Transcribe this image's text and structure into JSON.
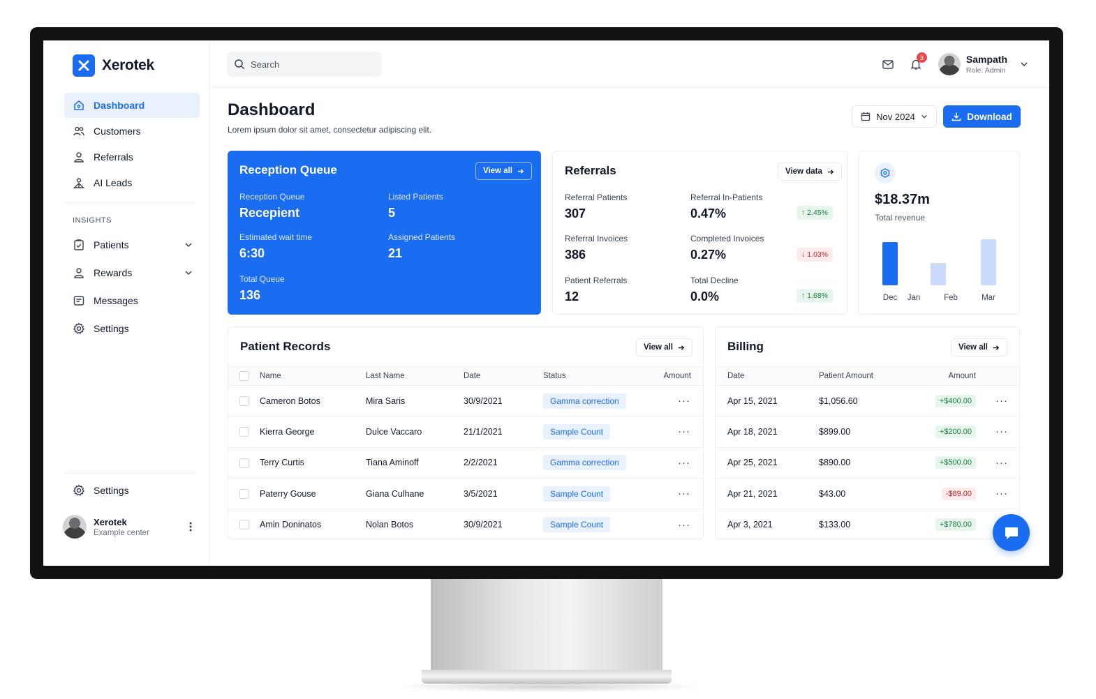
{
  "brand": {
    "name": "Xerotek",
    "accent": "#1a6cf0"
  },
  "sidebar": {
    "nav": [
      {
        "label": "Dashboard",
        "icon": "home-icon",
        "active": true
      },
      {
        "label": "Customers",
        "icon": "users-icon"
      },
      {
        "label": "Referrals",
        "icon": "user-icon"
      },
      {
        "label": "AI Leads",
        "icon": "ai-user-icon"
      }
    ],
    "section_label": "INSIGHTS",
    "insights": [
      {
        "label": "Patients",
        "icon": "clipboard-icon",
        "expandable": true
      },
      {
        "label": "Rewards",
        "icon": "user-icon",
        "expandable": true
      },
      {
        "label": "Messages",
        "icon": "message-icon"
      },
      {
        "label": "Settings",
        "icon": "gear-icon"
      }
    ],
    "bottom_settings": "Settings",
    "user": {
      "name": "Xerotek",
      "subtitle": "Example center"
    }
  },
  "header": {
    "search_placeholder": "Search",
    "notification_count": "3",
    "profile": {
      "name": "Sampath",
      "role": "Role: Admin"
    }
  },
  "page": {
    "title": "Dashboard",
    "subtitle": "Lorem ipsum dolor sit amet, consectetur adipiscing elit.",
    "date_filter": "Nov 2024",
    "download_label": "Download"
  },
  "reception": {
    "title": "Reception Queue",
    "view_all": "View all",
    "stats": [
      {
        "label": "Reception Queue",
        "value": "Recepient"
      },
      {
        "label": "Listed Patients",
        "value": "5"
      },
      {
        "label": "Estimated wait time",
        "value": "6:30"
      },
      {
        "label": "Assigned Patients",
        "value": "21"
      },
      {
        "label": "Total Queue",
        "value": "136"
      }
    ]
  },
  "referrals": {
    "title": "Referrals",
    "view_data": "View data",
    "stats": [
      {
        "label": "Referral Patients",
        "value": "307"
      },
      {
        "label": "Referral In-Patients",
        "value": "0.47%",
        "change": "2.45%",
        "direction": "up"
      },
      {
        "label": "Referral Invoices",
        "value": "386"
      },
      {
        "label": "Completed Invoices",
        "value": "0.27%",
        "change": "1.03%",
        "direction": "down"
      },
      {
        "label": "Patient Referrals",
        "value": "12"
      },
      {
        "label": "Total Decline",
        "value": "0.0%",
        "change": "1.68%",
        "direction": "up"
      }
    ]
  },
  "revenue": {
    "value": "$18.37m",
    "label": "Total revenue",
    "chart_labels": [
      "Dec",
      "Jan",
      "Feb",
      "Mar"
    ]
  },
  "patient_records": {
    "title": "Patient Records",
    "view_all": "View all",
    "columns": [
      "Name",
      "Last Name",
      "Date",
      "Status",
      "Amount"
    ],
    "rows": [
      {
        "name": "Cameron Botos",
        "last": "Mira Saris",
        "date": "30/9/2021",
        "status": "Gamma correction"
      },
      {
        "name": "Kierra George",
        "last": "Dulce Vaccaro",
        "date": "21/1/2021",
        "status": "Sample Count"
      },
      {
        "name": "Terry Curtis",
        "last": "Tiana Aminoff",
        "date": "2/2/2021",
        "status": "Gamma correction"
      },
      {
        "name": "Paterry Gouse",
        "last": "Giana Culhane",
        "date": "3/5/2021",
        "status": "Sample Count"
      },
      {
        "name": "Amin Doninatos",
        "last": "Nolan Botos",
        "date": "30/9/2021",
        "status": "Sample Count"
      }
    ]
  },
  "billing": {
    "title": "Billing",
    "view_all": "View all",
    "columns": [
      "Date",
      "Patient Amount",
      "Amount"
    ],
    "rows": [
      {
        "date": "Apr 15, 2021",
        "patient_amount": "$1,056.60",
        "amount": "+$400.00",
        "positive": true
      },
      {
        "date": "Apr 18, 2021",
        "patient_amount": "$899.00",
        "amount": "+$200.00",
        "positive": true
      },
      {
        "date": "Apr 25, 2021",
        "patient_amount": "$890.00",
        "amount": "+$500.00",
        "positive": true
      },
      {
        "date": "Apr 21, 2021",
        "patient_amount": "$43.00",
        "amount": "-$89.00",
        "positive": false
      },
      {
        "date": "Apr 3, 2021",
        "patient_amount": "$133.00",
        "amount": "+$780.00",
        "positive": true
      }
    ]
  }
}
